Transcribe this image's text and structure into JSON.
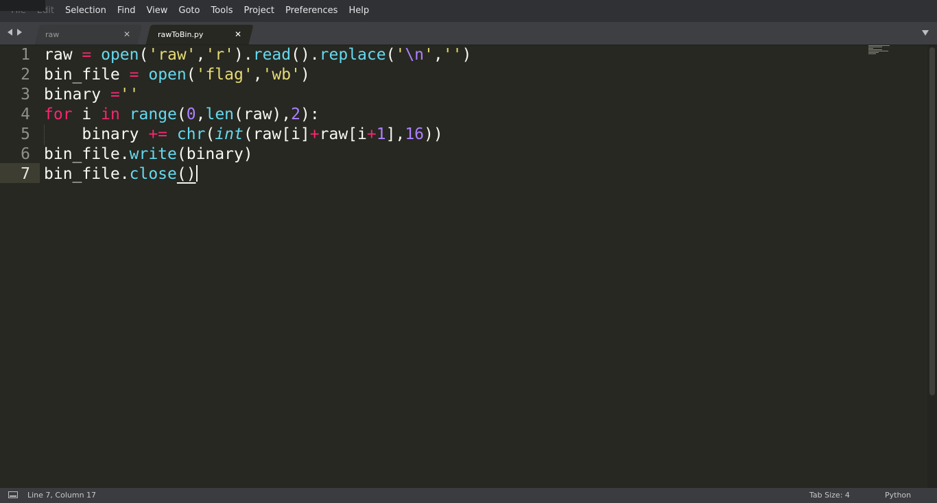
{
  "menu": {
    "items": [
      "File",
      "Edit",
      "Selection",
      "Find",
      "View",
      "Goto",
      "Tools",
      "Project",
      "Preferences",
      "Help"
    ]
  },
  "tabs": [
    {
      "label": "raw",
      "active": false,
      "close": "✕"
    },
    {
      "label": "rawToBin.py",
      "active": true,
      "close": "✕"
    }
  ],
  "editor": {
    "current_line": 7,
    "line_numbers": [
      "1",
      "2",
      "3",
      "4",
      "5",
      "6",
      "7"
    ],
    "lines": [
      [
        {
          "t": "raw ",
          "c": "plain"
        },
        {
          "t": "=",
          "c": "op"
        },
        {
          "t": " ",
          "c": "plain"
        },
        {
          "t": "open",
          "c": "fn"
        },
        {
          "t": "(",
          "c": "plain"
        },
        {
          "t": "'raw'",
          "c": "str"
        },
        {
          "t": ",",
          "c": "plain"
        },
        {
          "t": "'r'",
          "c": "str"
        },
        {
          "t": ").",
          "c": "plain"
        },
        {
          "t": "read",
          "c": "fn"
        },
        {
          "t": "().",
          "c": "plain"
        },
        {
          "t": "replace",
          "c": "fn"
        },
        {
          "t": "(",
          "c": "plain"
        },
        {
          "t": "'",
          "c": "str"
        },
        {
          "t": "\\n",
          "c": "esc"
        },
        {
          "t": "'",
          "c": "str"
        },
        {
          "t": ",",
          "c": "plain"
        },
        {
          "t": "''",
          "c": "str"
        },
        {
          "t": ")",
          "c": "plain"
        }
      ],
      [
        {
          "t": "bin_file ",
          "c": "plain"
        },
        {
          "t": "=",
          "c": "op"
        },
        {
          "t": " ",
          "c": "plain"
        },
        {
          "t": "open",
          "c": "fn"
        },
        {
          "t": "(",
          "c": "plain"
        },
        {
          "t": "'flag'",
          "c": "str"
        },
        {
          "t": ",",
          "c": "plain"
        },
        {
          "t": "'wb'",
          "c": "str"
        },
        {
          "t": ")",
          "c": "plain"
        }
      ],
      [
        {
          "t": "binary ",
          "c": "plain"
        },
        {
          "t": "=",
          "c": "op"
        },
        {
          "t": "''",
          "c": "str"
        }
      ],
      [
        {
          "t": "for",
          "c": "kw"
        },
        {
          "t": " i ",
          "c": "plain"
        },
        {
          "t": "in",
          "c": "kw"
        },
        {
          "t": " ",
          "c": "plain"
        },
        {
          "t": "range",
          "c": "fn"
        },
        {
          "t": "(",
          "c": "plain"
        },
        {
          "t": "0",
          "c": "num"
        },
        {
          "t": ",",
          "c": "plain"
        },
        {
          "t": "len",
          "c": "fn"
        },
        {
          "t": "(raw),",
          "c": "plain"
        },
        {
          "t": "2",
          "c": "num"
        },
        {
          "t": "):",
          "c": "plain"
        }
      ],
      [
        {
          "t": "    binary ",
          "c": "plain"
        },
        {
          "t": "+=",
          "c": "op"
        },
        {
          "t": " ",
          "c": "plain"
        },
        {
          "t": "chr",
          "c": "fn"
        },
        {
          "t": "(",
          "c": "plain"
        },
        {
          "t": "int",
          "c": "it"
        },
        {
          "t": "(raw[i]",
          "c": "plain"
        },
        {
          "t": "+",
          "c": "op"
        },
        {
          "t": "raw[i",
          "c": "plain"
        },
        {
          "t": "+",
          "c": "op"
        },
        {
          "t": "1",
          "c": "num"
        },
        {
          "t": "],",
          "c": "plain"
        },
        {
          "t": "16",
          "c": "num"
        },
        {
          "t": "))",
          "c": "plain"
        }
      ],
      [
        {
          "t": "bin_file.",
          "c": "plain"
        },
        {
          "t": "write",
          "c": "fn"
        },
        {
          "t": "(binary)",
          "c": "plain"
        }
      ],
      [
        {
          "t": "bin_file.",
          "c": "plain"
        },
        {
          "t": "close",
          "c": "fn"
        },
        {
          "t": "()",
          "c": "bracket-match"
        }
      ]
    ]
  },
  "status": {
    "position": "Line 7, Column 17",
    "tab_size": "Tab Size: 4",
    "syntax": "Python"
  },
  "colors": {
    "background": "#272822",
    "keyword": "#f92672",
    "function": "#66d9ef",
    "string": "#e6db74",
    "number": "#ae81ff",
    "text": "#f8f8f2"
  }
}
